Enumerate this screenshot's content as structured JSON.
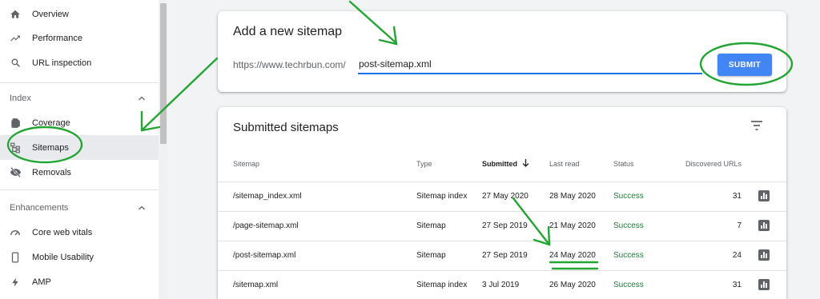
{
  "sidebar": {
    "items_top": [
      {
        "label": "Overview",
        "icon": "home-icon"
      },
      {
        "label": "Performance",
        "icon": "trending-up-icon"
      },
      {
        "label": "URL inspection",
        "icon": "search-icon"
      }
    ],
    "index_section": {
      "label": "Index",
      "items": [
        {
          "label": "Coverage",
          "icon": "coverage-icon"
        },
        {
          "label": "Sitemaps",
          "icon": "sitemaps-icon"
        },
        {
          "label": "Removals",
          "icon": "removals-icon"
        }
      ]
    },
    "enhancements_section": {
      "label": "Enhancements",
      "items": [
        {
          "label": "Core web vitals",
          "icon": "speedometer-icon"
        },
        {
          "label": "Mobile Usability",
          "icon": "phone-icon"
        },
        {
          "label": "AMP",
          "icon": "bolt-icon"
        }
      ]
    }
  },
  "add_sitemap": {
    "title": "Add a new sitemap",
    "prefix": "https://www.techrbun.com/",
    "input_value": "post-sitemap.xml",
    "submit_label": "SUBMIT"
  },
  "submitted": {
    "title": "Submitted sitemaps",
    "columns": {
      "sitemap": "Sitemap",
      "type": "Type",
      "submitted": "Submitted",
      "last_read": "Last read",
      "status": "Status",
      "discovered": "Discovered URLs"
    },
    "rows": [
      {
        "sitemap": "/sitemap_index.xml",
        "type": "Sitemap index",
        "submitted": "27 May 2020",
        "last_read": "28 May 2020",
        "status": "Success",
        "discovered": "31"
      },
      {
        "sitemap": "/page-sitemap.xml",
        "type": "Sitemap",
        "submitted": "27 Sep 2019",
        "last_read": "21 May 2020",
        "status": "Success",
        "discovered": "7"
      },
      {
        "sitemap": "/post-sitemap.xml",
        "type": "Sitemap",
        "submitted": "27 Sep 2019",
        "last_read": "24 May 2020",
        "status": "Success",
        "discovered": "24"
      },
      {
        "sitemap": "/sitemap.xml",
        "type": "Sitemap index",
        "submitted": "3 Jul 2019",
        "last_read": "26 May 2020",
        "status": "Success",
        "discovered": "31"
      }
    ]
  },
  "colors": {
    "accent": "#4285f4",
    "input_underline": "#1a73e8",
    "success": "#188038",
    "annotation": "#23a534"
  }
}
